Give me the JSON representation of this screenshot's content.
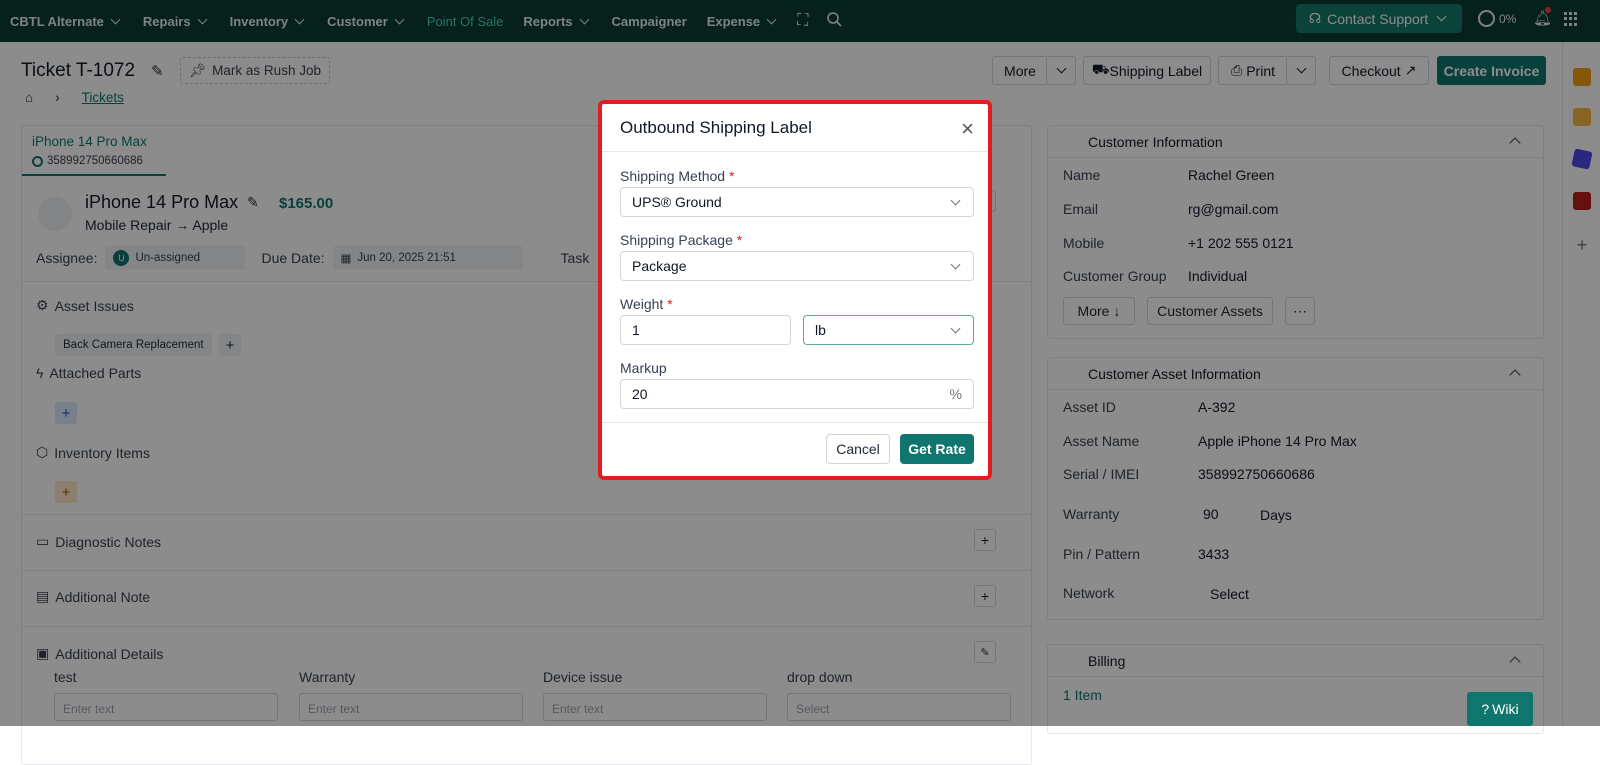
{
  "topnav": {
    "items": [
      {
        "label": "CBTL Alternate",
        "dropdown": true
      },
      {
        "label": "Repairs",
        "dropdown": true
      },
      {
        "label": "Inventory",
        "dropdown": true
      },
      {
        "label": "Customer",
        "dropdown": true
      },
      {
        "label": "Point Of Sale",
        "dropdown": false,
        "active": true
      },
      {
        "label": "Reports",
        "dropdown": true
      },
      {
        "label": "Campaigner",
        "dropdown": false
      },
      {
        "label": "Expense",
        "dropdown": true
      }
    ],
    "support_label": "Contact Support",
    "progress_label": "0%"
  },
  "header": {
    "title": "Ticket T-1072",
    "rush_label": "Mark as Rush Job",
    "breadcrumb": "Tickets",
    "buttons": {
      "more": "More",
      "shipping_label": "Shipping Label",
      "print": "Print",
      "checkout": "Checkout",
      "create_invoice": "Create Invoice"
    }
  },
  "asset": {
    "tab_name": "iPhone 14 Pro Max",
    "tab_imei": "358992750660686",
    "title": "iPhone 14 Pro Max",
    "price": "$165.00",
    "subtitle": "Mobile Repair → Apple",
    "assignee_label": "Assignee:",
    "assignee_value": "Un-assigned",
    "assignee_initial": "U",
    "due_label": "Due Date:",
    "due_value": "Jun 20, 2025 21:51",
    "task_label": "Task"
  },
  "sections": {
    "asset_issues": "Asset Issues",
    "issue_tag": "Back Camera Replacement",
    "attached_parts": "Attached Parts",
    "inventory_items": "Inventory Items",
    "diagnostic_notes": "Diagnostic Notes",
    "additional_note": "Additional Note",
    "additional_details": "Additional Details"
  },
  "details_fields": [
    {
      "label": "test",
      "placeholder": "Enter text"
    },
    {
      "label": "Warranty",
      "placeholder": "Enter text"
    },
    {
      "label": "Device issue",
      "placeholder": "Enter text"
    },
    {
      "label": "drop down",
      "placeholder": "Select"
    }
  ],
  "customer": {
    "heading": "Customer Information",
    "fields": [
      {
        "label": "Name",
        "value": "Rachel Green"
      },
      {
        "label": "Email",
        "value": "rg@gmail.com"
      },
      {
        "label": "Mobile",
        "value": "+1 202 555 0121"
      },
      {
        "label": "Customer Group",
        "value": "Individual"
      }
    ],
    "more_label": "More",
    "assets_label": "Customer Assets"
  },
  "asset_info": {
    "heading": "Customer Asset Information",
    "fields": [
      {
        "label": "Asset ID",
        "value": "A-392"
      },
      {
        "label": "Asset Name",
        "value": "Apple iPhone 14 Pro Max"
      },
      {
        "label": "Serial / IMEI",
        "value": "358992750660686"
      },
      {
        "label": "Warranty",
        "value": "90"
      },
      {
        "label": "Pin / Pattern",
        "value": "3433"
      },
      {
        "label": "Network",
        "value": "Select"
      }
    ],
    "warranty_unit": "Days"
  },
  "billing": {
    "heading": "Billing",
    "items_label": "1 Item"
  },
  "modal": {
    "title": "Outbound Shipping Label",
    "shipping_method_label": "Shipping Method",
    "shipping_method_value": "UPS® Ground",
    "package_label": "Shipping Package",
    "package_value": "Package",
    "weight_label": "Weight",
    "weight_value": "1",
    "weight_unit": "lb",
    "markup_label": "Markup",
    "markup_value": "20",
    "markup_suffix": "%",
    "required_mark": "*",
    "cancel": "Cancel",
    "get_rate": "Get Rate"
  },
  "wiki_label": "Wiki"
}
